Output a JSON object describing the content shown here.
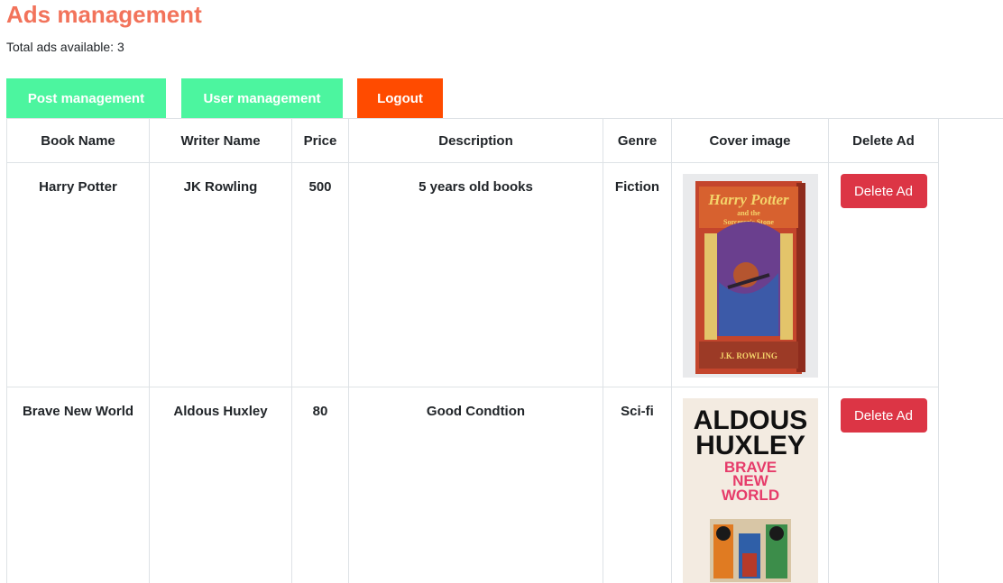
{
  "page": {
    "title": "Ads management",
    "subtitle": "Total ads available: 3"
  },
  "nav": {
    "post_label": "Post management",
    "user_label": "User management",
    "logout_label": "Logout"
  },
  "colors": {
    "title": "#f2735b",
    "nav_green": "#4cf59f",
    "logout_orange": "#ff4b00",
    "delete_red": "#dc3545"
  },
  "table": {
    "headers": [
      "Book Name",
      "Writer Name",
      "Price",
      "Description",
      "Genre",
      "Cover image",
      "Delete Ad"
    ],
    "rows": [
      {
        "book": "Harry Potter",
        "writer": "JK Rowling",
        "price": "500",
        "description": "5 years old books",
        "genre": "Fiction",
        "cover_text": [
          "Harry Potter",
          "and the",
          "Sorcerer's Stone",
          "J.K. ROWLING"
        ],
        "delete_label": "Delete Ad"
      },
      {
        "book": "Brave New World",
        "writer": "Aldous Huxley",
        "price": "80",
        "description": "Good Condtion",
        "genre": "Sci-fi",
        "cover_text": [
          "ALDOUS",
          "HUXLEY",
          "BRAVE",
          "NEW",
          "WORLD"
        ],
        "delete_label": "Delete Ad"
      }
    ]
  }
}
